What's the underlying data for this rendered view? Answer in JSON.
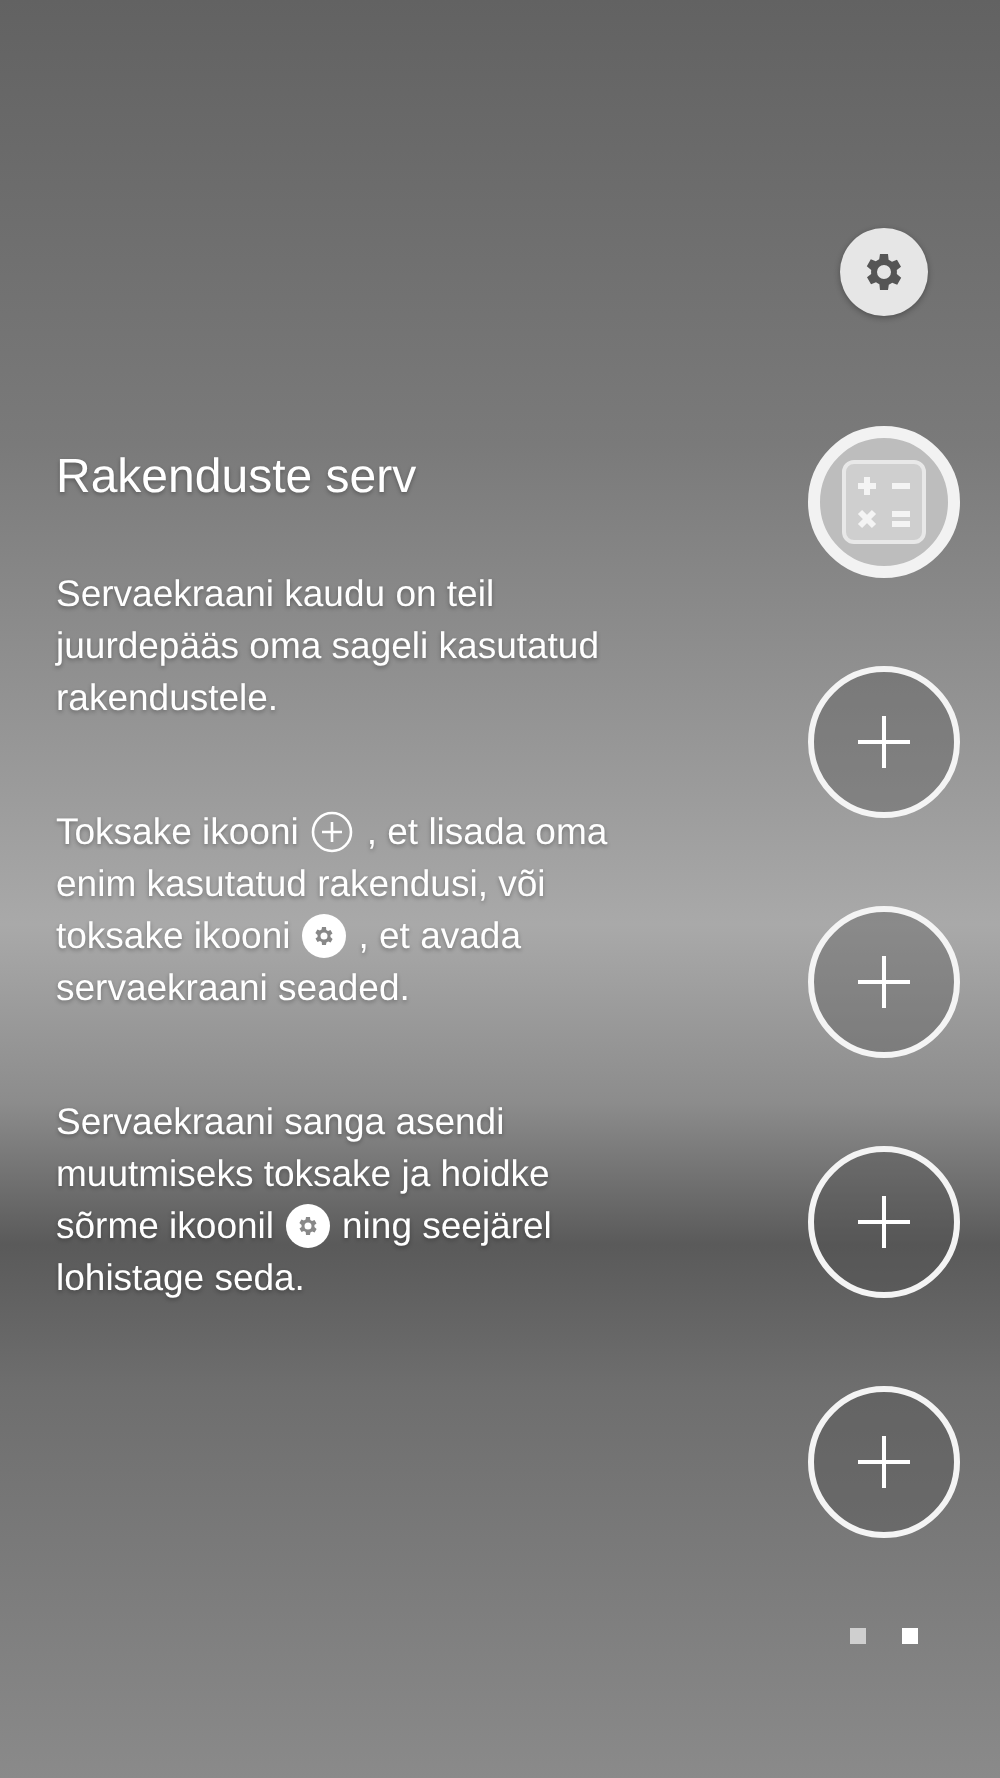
{
  "title": "Rakenduste serv",
  "paragraphs": [
    {
      "lines": [
        [
          {
            "kind": "text",
            "text": "Servaekraani kaudu on teil"
          }
        ],
        [
          {
            "kind": "text",
            "text": "juurdepääs oma sageli kasutatud"
          }
        ],
        [
          {
            "kind": "text",
            "text": "rakendustele."
          }
        ]
      ]
    },
    {
      "lines": [
        [
          {
            "kind": "text",
            "text": "Toksake ikooni"
          },
          {
            "kind": "plus"
          },
          {
            "kind": "text",
            "text": ", et lisada oma"
          }
        ],
        [
          {
            "kind": "text",
            "text": "enim kasutatud rakendusi, või"
          }
        ],
        [
          {
            "kind": "text",
            "text": "toksake ikooni"
          },
          {
            "kind": "gear"
          },
          {
            "kind": "text",
            "text": ", et avada"
          }
        ],
        [
          {
            "kind": "text",
            "text": "servaekraani seaded."
          }
        ]
      ]
    },
    {
      "lines": [
        [
          {
            "kind": "text",
            "text": "Servaekraani sanga asendi"
          }
        ],
        [
          {
            "kind": "text",
            "text": "muutmiseks toksake ja hoidke"
          }
        ],
        [
          {
            "kind": "text",
            "text": "sõrme ikoonil"
          },
          {
            "kind": "gear"
          },
          {
            "kind": "text",
            "text": "ning seejärel"
          }
        ],
        [
          {
            "kind": "text",
            "text": "lohistage seda."
          }
        ]
      ]
    }
  ],
  "slots": [
    {
      "kind": "app"
    },
    {
      "kind": "add"
    },
    {
      "kind": "add"
    },
    {
      "kind": "add"
    },
    {
      "kind": "add"
    }
  ],
  "pages": [
    {
      "selected": false
    },
    {
      "selected": true
    }
  ]
}
